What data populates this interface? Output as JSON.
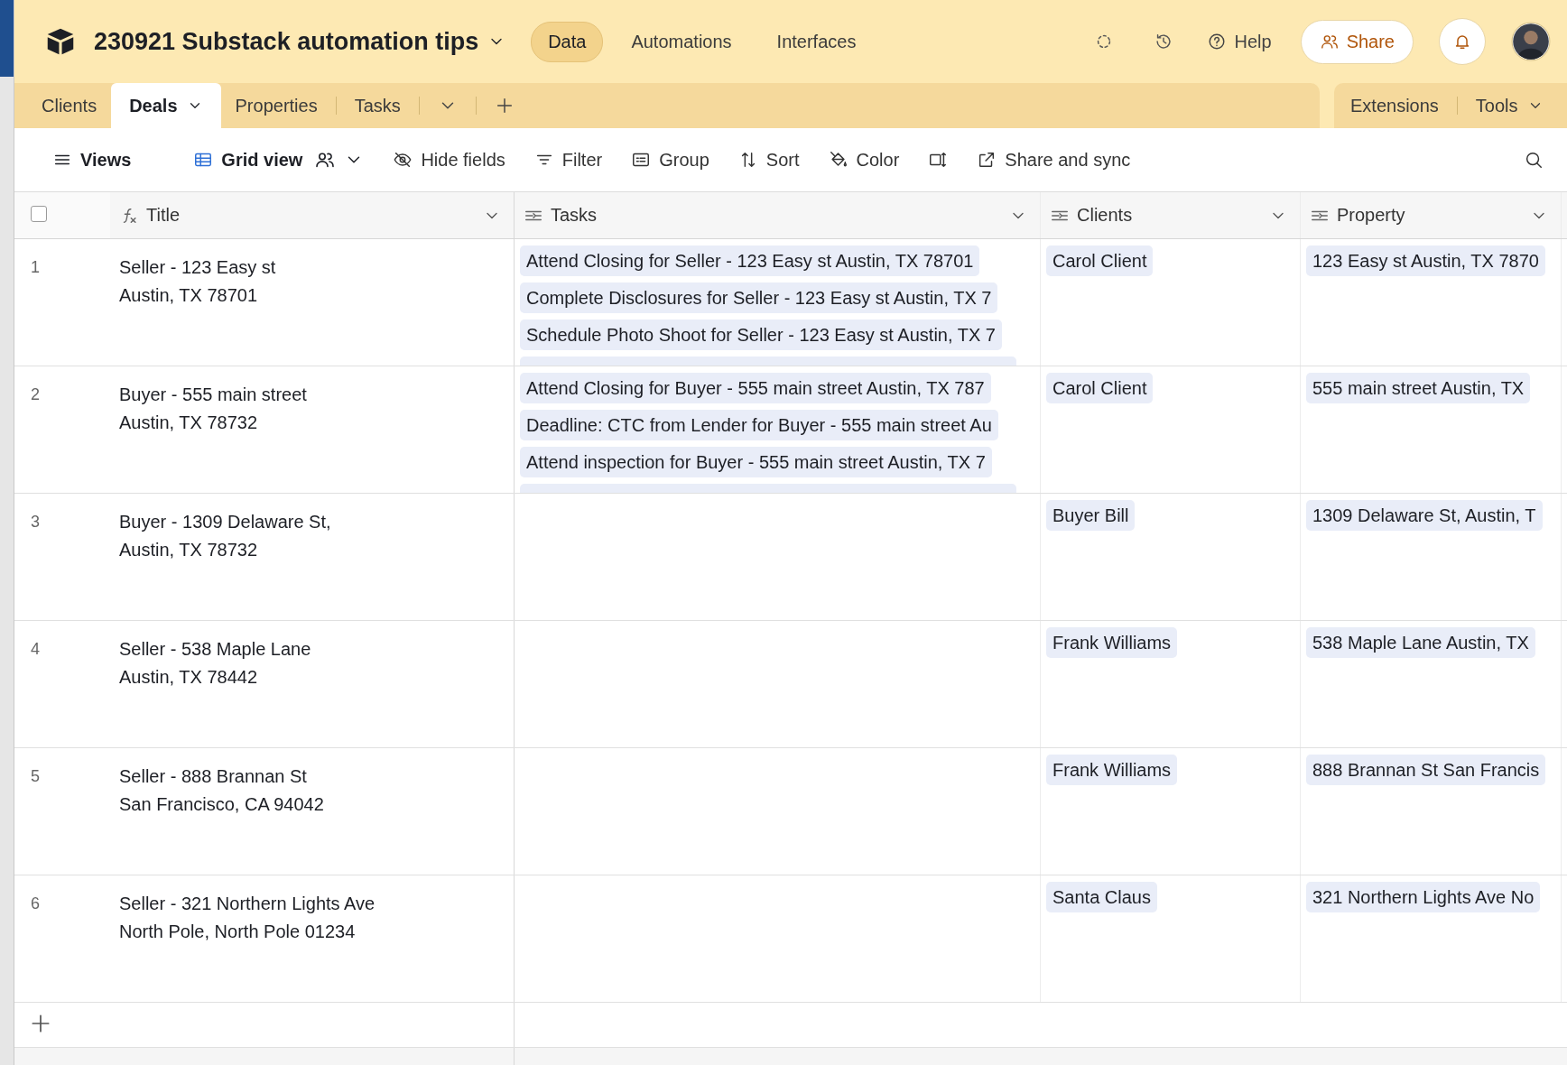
{
  "app_bar": {
    "base_name": "230921 Substack automation tips",
    "nav": [
      {
        "label": "Data",
        "selected": true
      },
      {
        "label": "Automations",
        "selected": false
      },
      {
        "label": "Interfaces",
        "selected": false
      }
    ],
    "help": "Help",
    "share": "Share"
  },
  "tables_bar": {
    "tabs": [
      {
        "label": "Clients",
        "selected": false
      },
      {
        "label": "Deals",
        "selected": true
      },
      {
        "label": "Properties",
        "selected": false
      },
      {
        "label": "Tasks",
        "selected": false
      }
    ],
    "tools": [
      "Extensions",
      "Tools"
    ]
  },
  "toolbar": {
    "views": "Views",
    "view_name": "Grid view",
    "items": [
      {
        "kind": "hide",
        "label": "Hide fields"
      },
      {
        "kind": "filter",
        "label": "Filter"
      },
      {
        "kind": "group",
        "label": "Group"
      },
      {
        "kind": "sort",
        "label": "Sort"
      },
      {
        "kind": "color",
        "label": "Color"
      },
      {
        "kind": "rowheight"
      },
      {
        "kind": "share",
        "label": "Share and sync"
      }
    ]
  },
  "grid": {
    "select_all": {
      "checked": false
    },
    "columns": [
      {
        "name": "Title",
        "kind": "formula"
      },
      {
        "name": "Tasks",
        "kind": "link"
      },
      {
        "name": "Clients",
        "kind": "link"
      },
      {
        "name": "Property",
        "kind": "link"
      }
    ],
    "rows": [
      {
        "number": "1",
        "title": "Seller - 123 Easy st\nAustin, TX 78701",
        "tasks": [
          "Attend Closing for Seller - 123 Easy st Austin, TX 78701",
          "Complete Disclosures for Seller - 123 Easy st Austin, TX 7",
          "Schedule Photo Shoot for Seller - 123 Easy st Austin, TX 7"
        ],
        "more_tasks": true,
        "clients": [
          "Carol Client"
        ],
        "property": [
          "123 Easy st Austin, TX 7870"
        ]
      },
      {
        "number": "2",
        "title": "Buyer - 555 main street\nAustin, TX 78732",
        "tasks": [
          "Attend Closing for Buyer - 555 main street Austin, TX 787",
          "Deadline: CTC from Lender for Buyer - 555 main street Au",
          "Attend inspection for Buyer - 555 main street Austin, TX 7"
        ],
        "more_tasks": true,
        "clients": [
          "Carol Client"
        ],
        "property": [
          "555 main street Austin, TX"
        ]
      },
      {
        "number": "3",
        "title": "Buyer - 1309 Delaware St,\nAustin, TX 78732",
        "tasks": [],
        "more_tasks": false,
        "clients": [
          "Buyer Bill"
        ],
        "property": [
          "1309 Delaware St, Austin, T"
        ]
      },
      {
        "number": "4",
        "title": "Seller - 538 Maple Lane\nAustin, TX 78442",
        "tasks": [],
        "more_tasks": false,
        "clients": [
          "Frank Williams"
        ],
        "property": [
          "538 Maple Lane Austin, TX"
        ]
      },
      {
        "number": "5",
        "title": "Seller - 888 Brannan St\nSan Francisco, CA 94042",
        "tasks": [],
        "more_tasks": false,
        "clients": [
          "Frank Williams"
        ],
        "property": [
          "888 Brannan St San Francis"
        ]
      },
      {
        "number": "6",
        "title": "Seller - 321 Northern Lights Ave\nNorth Pole, North Pole 01234",
        "tasks": [],
        "more_tasks": false,
        "clients": [
          "Santa Claus"
        ],
        "property": [
          "321 Northern Lights Ave No"
        ]
      }
    ]
  }
}
